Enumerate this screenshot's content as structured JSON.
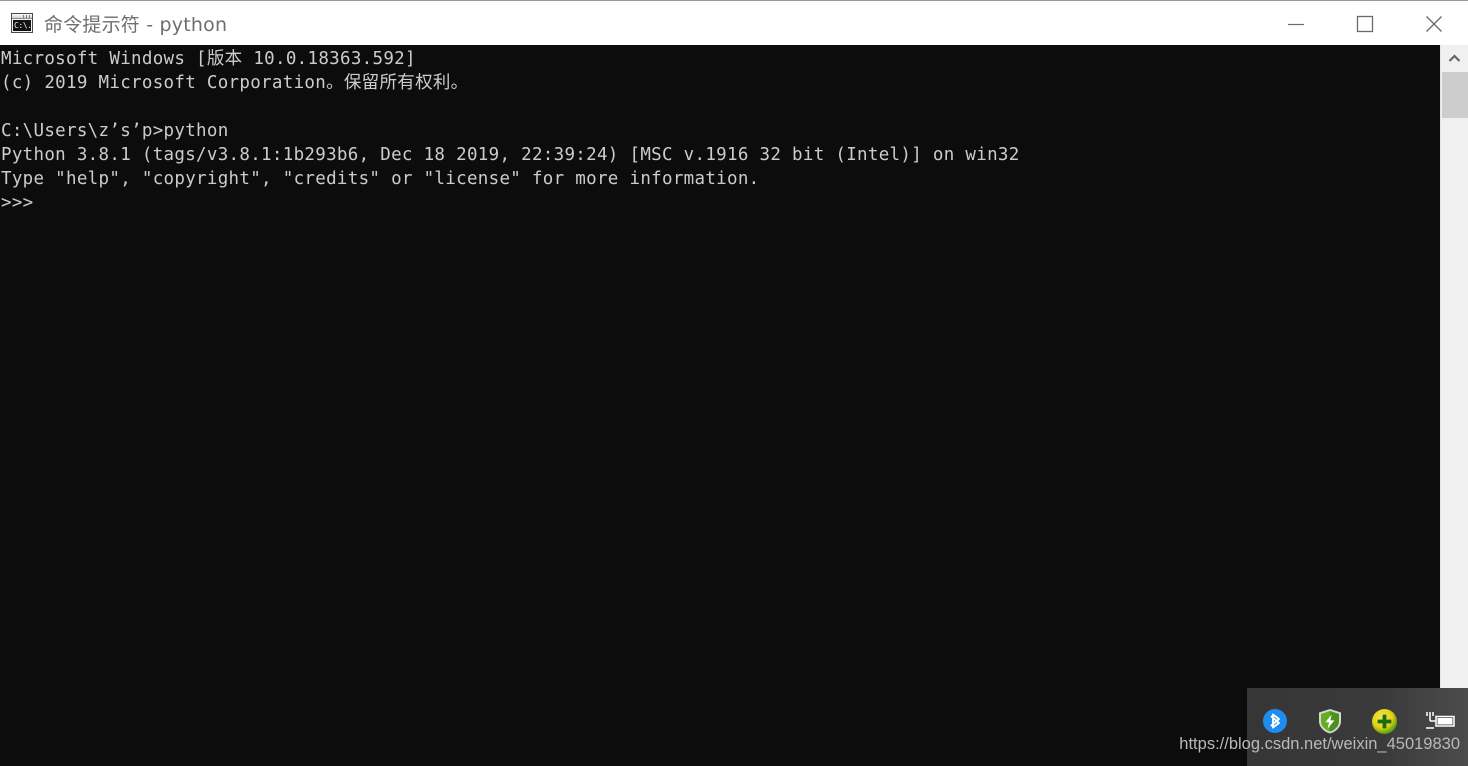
{
  "window": {
    "title": "命令提示符 - python",
    "icon_name": "cmd-console-icon",
    "icon_text": "C:\\.",
    "background_color": "#0c0c0c",
    "titlebar_color": "#ffffff",
    "title_text_color": "#6e6e6e"
  },
  "window_controls": {
    "minimize_label": "最小化",
    "maximize_label": "最大化",
    "close_label": "关闭"
  },
  "console": {
    "text_color": "#cccccc",
    "lines": [
      "Microsoft Windows [版本 10.0.18363.592]",
      "(c) 2019 Microsoft Corporation。保留所有权利。",
      "",
      "C:\\Users\\z’s’p>python",
      "Python 3.8.1 (tags/v3.8.1:1b293b6, Dec 18 2019, 22:39:24) [MSC v.1916 32 bit (Intel)] on win32",
      "Type \"help\", \"copyright\", \"credits\" or \"license\" for more information.",
      ">>>"
    ],
    "full_text": "Microsoft Windows [版本 10.0.18363.592]\n(c) 2019 Microsoft Corporation。保留所有权利。\n\nC:\\Users\\z’s’p>python\nPython 3.8.1 (tags/v3.8.1:1b293b6, Dec 18 2019, 22:39:24) [MSC v.1916 32 bit (Intel)] on win32\nType \"help\", \"copyright\", \"credits\" or \"license\" for more information.\n>>>"
  },
  "scrollbar": {
    "up_arrow_name": "chevron-up-icon",
    "down_arrow_name": "chevron-down-icon",
    "track_color": "#f0f0f0",
    "thumb_color": "#cdcdcd"
  },
  "tray": {
    "background_color": "#3a3a3a",
    "icons": [
      {
        "name": "bluetooth-icon",
        "color": "#1f8cf0"
      },
      {
        "name": "shield-security-icon",
        "color": "#63ad23"
      },
      {
        "name": "plus-circle-icon",
        "color": "#d6c81e"
      },
      {
        "name": "battery-charging-icon",
        "color": "#ffffff"
      }
    ]
  },
  "watermark": {
    "text": "https://blog.csdn.net/weixin_45019830",
    "color": "#b9b9b9"
  }
}
